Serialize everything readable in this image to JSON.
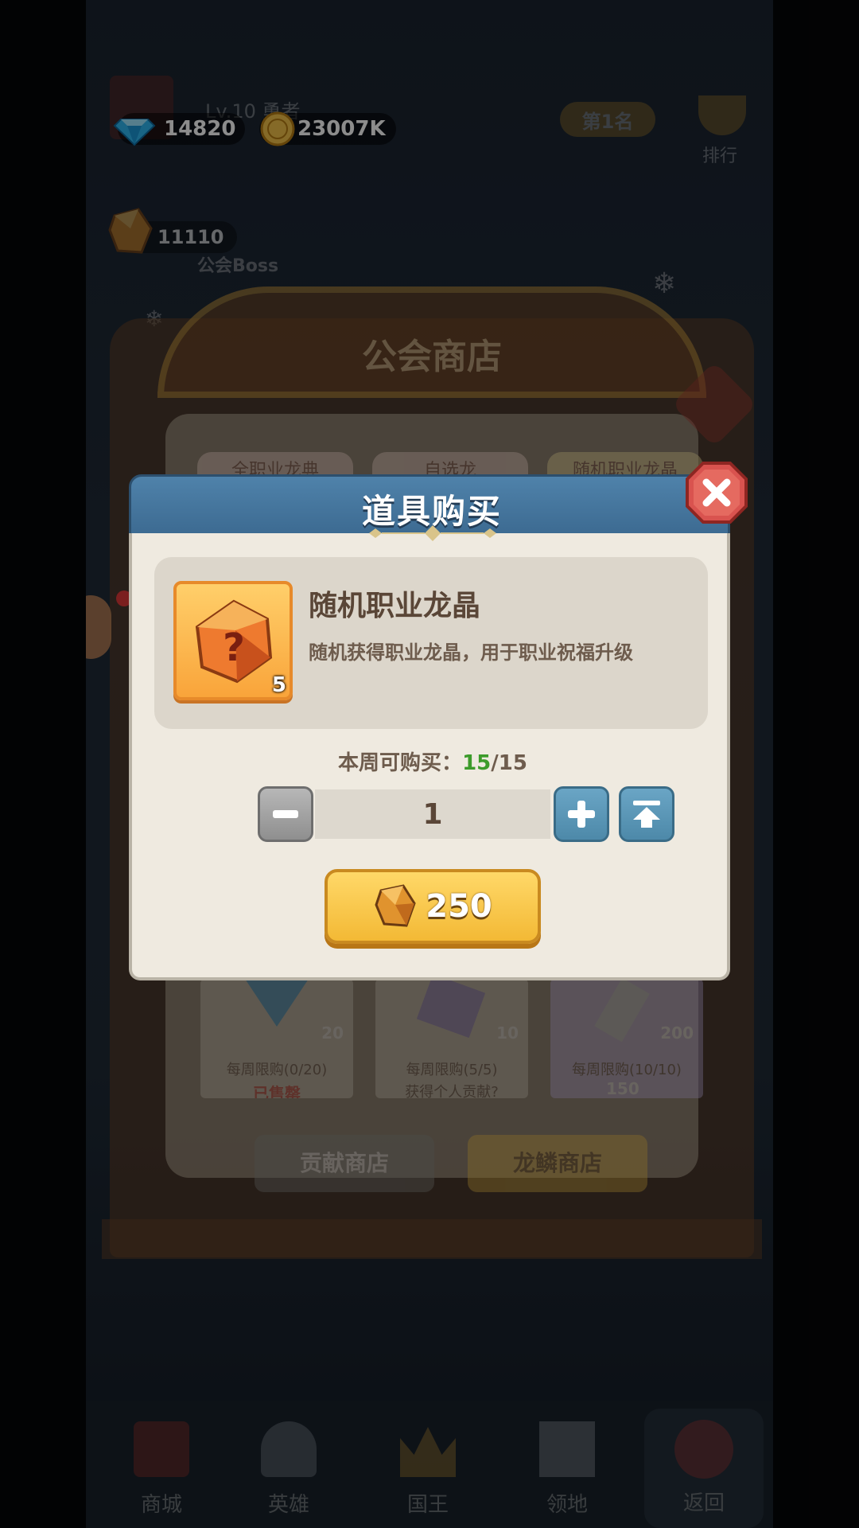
{
  "top_bar": {
    "diamonds": "14820",
    "gold": "23007K",
    "player_level": "Lv.10 勇者",
    "rank_label": "第1名",
    "rank_caption": "排行"
  },
  "guild": {
    "dragon_crystal_count": "11110",
    "boss_label": "公会Boss"
  },
  "shop": {
    "title": "公会商店",
    "tabs": [
      "全职业龙典",
      "自选龙",
      "随机职业龙晶"
    ],
    "items": [
      {
        "count": "20",
        "limit": "每周限购(0/20)",
        "status": "已售罄"
      },
      {
        "count": "10",
        "limit": "每周限购(5/5)",
        "status": "获得个人贡献?"
      },
      {
        "count": "200",
        "limit": "每周限购(10/10)",
        "price": "150"
      }
    ],
    "bottom_tabs": {
      "contribution": "贡献商店",
      "dragon_scale": "龙鳞商店"
    }
  },
  "bottom_nav": [
    "商城",
    "英雄",
    "国王",
    "领地",
    "返回"
  ],
  "dialog": {
    "title": "道具购买",
    "item_name": "随机职业龙晶",
    "item_desc": "随机获得职业龙晶，用于职业祝福升级",
    "item_count": "5",
    "limit_label": "本周可购买：",
    "limit_current": "15",
    "limit_sep": "/",
    "limit_max": "15",
    "quantity": "1",
    "price": "250"
  },
  "colors": {
    "dialog_header": "#4f82aa",
    "dialog_body": "#efeae0",
    "buy_button": "#f3b935",
    "limit_green": "#3c9b2a",
    "close_red": "#d9534f"
  }
}
